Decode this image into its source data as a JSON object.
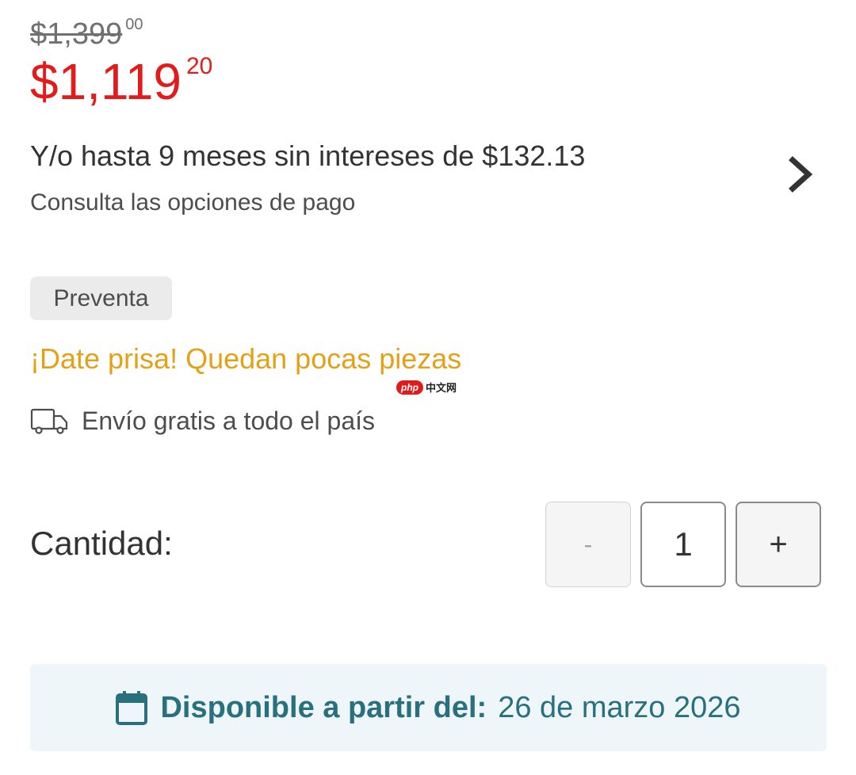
{
  "price": {
    "original_whole": "$1,399",
    "original_cents": "00",
    "current_whole": "$1,119",
    "current_cents": "20"
  },
  "installments": {
    "title": "Y/o hasta 9 meses sin intereses de $132.13",
    "subtitle": "Consulta las opciones de pago",
    "icon": "chevron-right-icon"
  },
  "badge": {
    "label": "Preventa"
  },
  "stock_warning": "¡Date prisa! Quedan pocas piezas",
  "watermark": {
    "logo": "php",
    "text": "中文网"
  },
  "shipping": {
    "icon": "truck-icon",
    "label": "Envío gratis a todo el país"
  },
  "quantity": {
    "label": "Cantidad:",
    "decrement": "-",
    "value": "1",
    "increment": "+"
  },
  "availability": {
    "icon": "calendar-icon",
    "label": "Disponible a partir del:",
    "date": "26 de marzo 2026"
  },
  "colors": {
    "price_red": "#e31b1b",
    "warning_orange": "#e4a117",
    "availability_teal": "#29707f",
    "availability_bg": "#eef6f9"
  }
}
